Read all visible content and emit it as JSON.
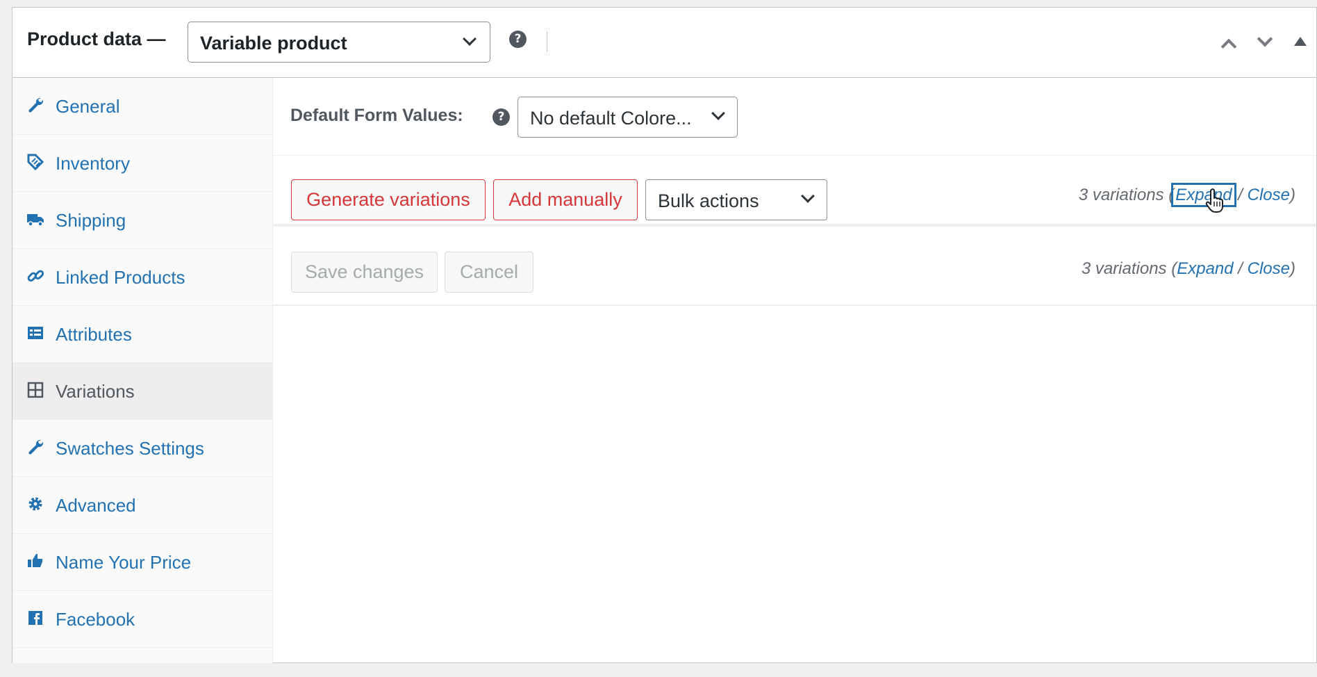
{
  "header": {
    "title": "Product data —",
    "product_type": "Variable product",
    "help": "?"
  },
  "sidebar": {
    "items": [
      {
        "label": "General",
        "icon": "wrench-icon"
      },
      {
        "label": "Inventory",
        "icon": "tag-icon"
      },
      {
        "label": "Shipping",
        "icon": "truck-icon"
      },
      {
        "label": "Linked Products",
        "icon": "link-icon"
      },
      {
        "label": "Attributes",
        "icon": "list-icon"
      },
      {
        "label": "Variations",
        "icon": "grid-icon",
        "active": true
      },
      {
        "label": "Swatches Settings",
        "icon": "wrench-icon"
      },
      {
        "label": "Advanced",
        "icon": "gear-icon"
      },
      {
        "label": "Name Your Price",
        "icon": "thumbs-up-icon"
      },
      {
        "label": "Facebook",
        "icon": "facebook-icon"
      }
    ]
  },
  "main": {
    "default_form_values_label": "Default Form Values:",
    "help": "?",
    "default_select": "No default Colore...",
    "generate_button": "Generate variations",
    "add_button": "Add manually",
    "bulk_select": "Bulk actions",
    "variations_top": {
      "count": "3 variations",
      "open": "(",
      "expand": "Expand",
      "sep": " / ",
      "close": "Close",
      "end": ")"
    },
    "save_button": "Save changes",
    "cancel_button": "Cancel",
    "variations_bottom": {
      "count": "3 variations",
      "open": "(",
      "expand": "Expand",
      "sep": " / ",
      "close": "Close",
      "end": ")"
    }
  },
  "colors": {
    "link": "#2271b1",
    "danger": "#d63638",
    "text": "#1d2327",
    "muted": "#646970"
  }
}
